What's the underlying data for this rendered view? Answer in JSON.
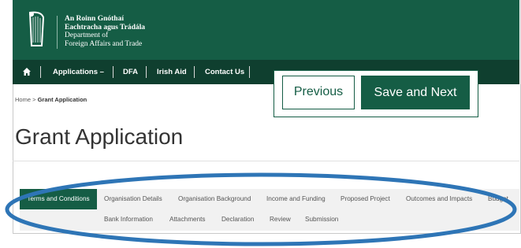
{
  "header": {
    "logo_lines": [
      "An Roinn Gnóthaí",
      "Eachtracha agus Trádála",
      "Department of",
      "Foreign Affairs and Trade"
    ],
    "harp_icon": "harp-icon"
  },
  "nav": {
    "home_icon": "home-icon",
    "items": [
      "Applications –",
      "DFA",
      "Irish Aid",
      "Contact Us"
    ]
  },
  "buttons": {
    "previous": "Previous",
    "save_next": "Save and Next"
  },
  "breadcrumb": {
    "home": "Home",
    "sep": ">",
    "current": "Grant Application"
  },
  "page": {
    "title": "Grant Application"
  },
  "tabs": {
    "row1": [
      "Terms and Conditions",
      "Organisation Details",
      "Organisation Background",
      "Income and Funding",
      "Proposed Project",
      "Outcomes and Impacts",
      "Budget"
    ],
    "row2": [
      "Bank Information",
      "Attachments",
      "Declaration",
      "Review",
      "Submission"
    ]
  },
  "colors": {
    "brand_green": "#155d45",
    "nav_dark": "#0f3f2f",
    "annotation_blue": "#2e75b6"
  }
}
